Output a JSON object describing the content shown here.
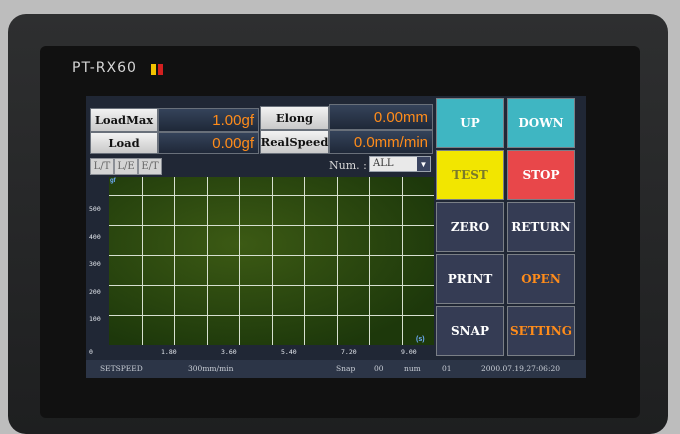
{
  "device": {
    "model": "PT-RX60"
  },
  "readouts": {
    "load_max": {
      "label": "LoadMax",
      "value": "1.00gf"
    },
    "load": {
      "label": "Load",
      "value": "0.00gf"
    },
    "elong": {
      "label": "Elong",
      "value": "0.00mm"
    },
    "real_speed": {
      "label": "RealSpeed",
      "value": "0.0mm/min"
    }
  },
  "chart_tabs": [
    "L/T",
    "L/E",
    "E/T"
  ],
  "num_selector": {
    "label": "Num. :",
    "value": "ALL"
  },
  "chart": {
    "y_axis_label": "gf",
    "x_axis_label": "(s)",
    "y_ticks": [
      "500",
      "400",
      "300",
      "200",
      "100",
      "0"
    ],
    "x_ticks": [
      "1.80",
      "3.60",
      "5.40",
      "7.20",
      "9.00"
    ]
  },
  "chart_data": {
    "type": "line",
    "title": "",
    "xlabel": "(s)",
    "ylabel": "gf",
    "xlim": [
      0,
      9.0
    ],
    "ylim": [
      0,
      500
    ],
    "series": [],
    "grid": true
  },
  "buttons": [
    {
      "label": "UP",
      "bg": "#3fb6c2",
      "fg": "#ffffff"
    },
    {
      "label": "DOWN",
      "bg": "#3fb6c2",
      "fg": "#ffffff"
    },
    {
      "label": "TEST",
      "bg": "#f2e600",
      "fg": "#7a7a2a"
    },
    {
      "label": "STOP",
      "bg": "#e8474a",
      "fg": "#ffffff"
    },
    {
      "label": "ZERO",
      "bg": "#353c54",
      "fg": "#ffffff"
    },
    {
      "label": "RETURN",
      "bg": "#353c54",
      "fg": "#ffffff"
    },
    {
      "label": "PRINT",
      "bg": "#353c54",
      "fg": "#ffffff"
    },
    {
      "label": "OPEN",
      "bg": "#353c54",
      "fg": "#ff8c1a"
    },
    {
      "label": "SNAP",
      "bg": "#353c54",
      "fg": "#ffffff"
    },
    {
      "label": "SETTING",
      "bg": "#353c54",
      "fg": "#ff8c1a"
    }
  ],
  "status_bar": {
    "speed_label": "SETSPEED",
    "speed_value": "300mm/min",
    "snap_label": "Snap",
    "snap_value": "00",
    "num_label": "num",
    "num_value": "01",
    "datetime": "2000.07.19,27:06:20"
  },
  "colors": {
    "value_text": "#ff8c1a",
    "plot_background": "#2c4a10",
    "grid": "#d7e0d0"
  }
}
